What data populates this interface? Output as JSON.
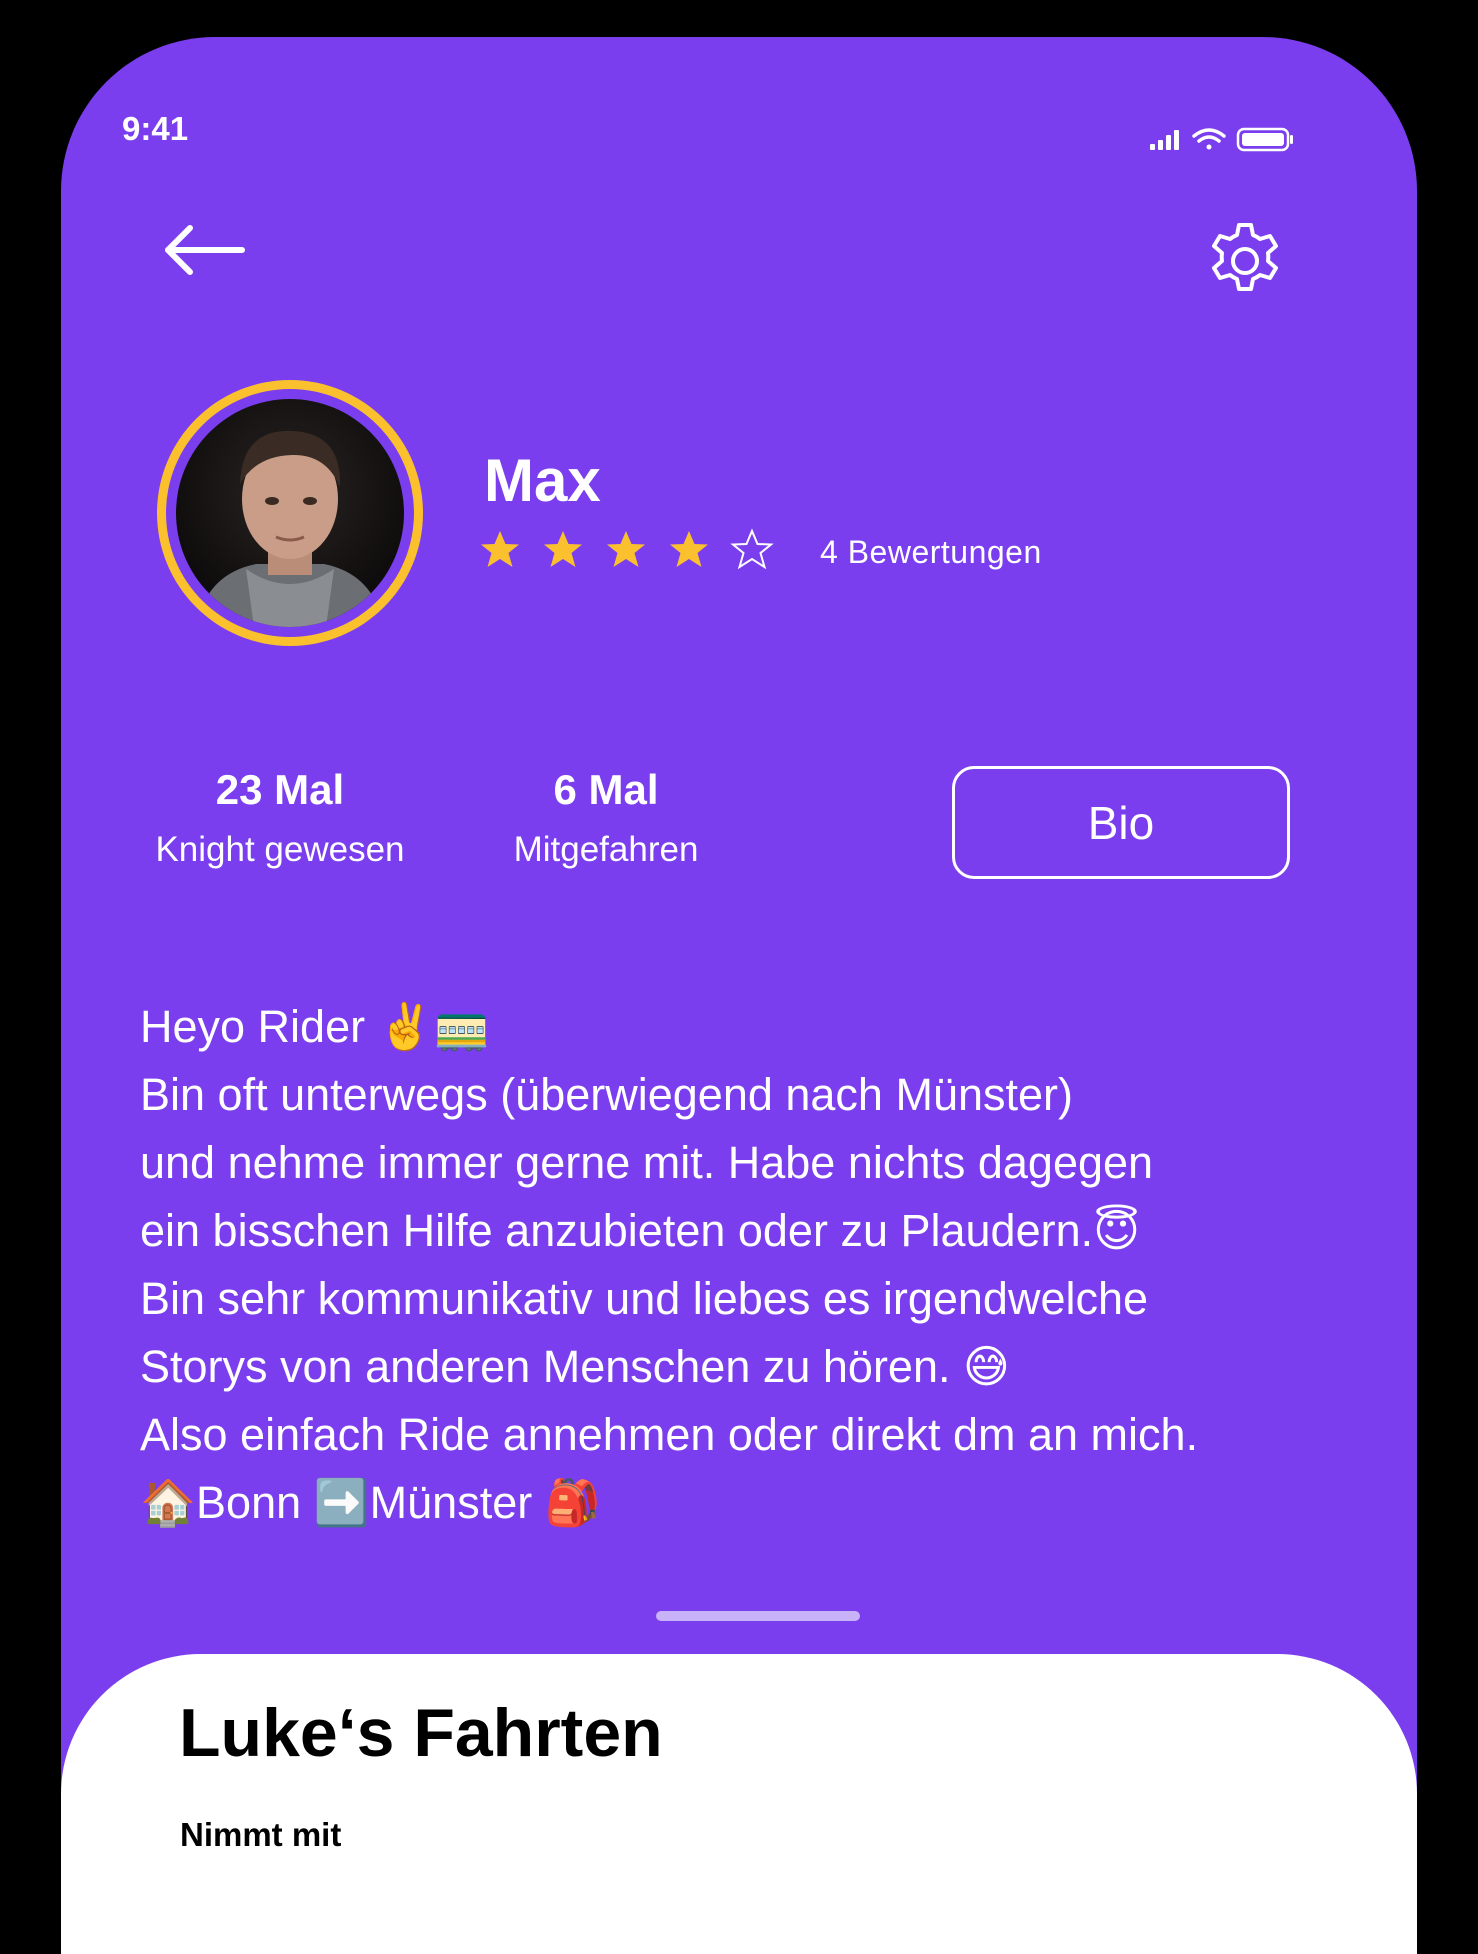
{
  "status_bar": {
    "time": "9:41",
    "icons": [
      "signal-icon",
      "wifi-icon",
      "battery-icon"
    ]
  },
  "header": {
    "back_icon": "arrow-left-icon",
    "settings_icon": "gear-icon"
  },
  "profile": {
    "name": "Max",
    "rating": 4,
    "rating_max": 5,
    "reviews_label": "4 Bewertungen",
    "avatar_ring_color": "#FBC02D"
  },
  "stats": [
    {
      "value": "23 Mal",
      "label": "Knight gewesen"
    },
    {
      "value": "6 Mal",
      "label": "Mitgefahren"
    }
  ],
  "bio_button_label": "Bio",
  "bio_lines": [
    "Heyo Rider ✌️🚃",
    "Bin oft unterwegs (überwiegend nach Münster)",
    "und nehme immer gerne mit. Habe nichts dagegen",
    "ein bisschen Hilfe anzubieten oder zu Plaudern.😇",
    "Bin sehr kommunikativ und liebes es irgendwelche",
    "Storys von anderen Menschen zu hören. 😅",
    "Also einfach Ride annehmen oder direkt dm an mich.",
    "🏠Bonn ➡️Münster 🎒"
  ],
  "sheet": {
    "title": "Luke‘s Fahrten",
    "subtitle": "Nimmt mit"
  },
  "colors": {
    "background": "#7B3EEE",
    "star": "#FBC02D",
    "text": "#FFFFFF"
  }
}
